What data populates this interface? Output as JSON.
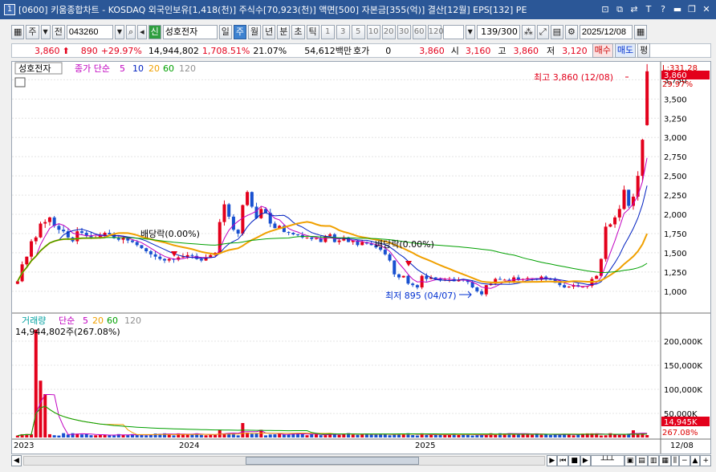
{
  "window": {
    "number": "1",
    "title": "[0600] 키움종합차트 - KOSDAQ 외국인보유[1,418(천)] 주식수[70,923(천)] 액면[500] 자본금[355(억)] 결산[12월] EPS[132] PE"
  },
  "toolbar": {
    "main_btn": "주",
    "jeon_btn": "전",
    "code_value": "043260",
    "sin_label": "신",
    "stock_name": "성호전자",
    "periods": [
      "일",
      "주",
      "월",
      "년"
    ],
    "selected_period": "주",
    "intervals": [
      "분",
      "초",
      "틱"
    ],
    "numbers": [
      "1",
      "3",
      "5",
      "10",
      "20",
      "30",
      "60",
      "120"
    ],
    "count_value": "139",
    "count_total": "/300",
    "date_value": "2025/12/08"
  },
  "quote": {
    "price": "3,860",
    "change": "890",
    "change_pct": "+29.97%",
    "volume": "14,944,802",
    "volume_pct": "1,708.51%",
    "turnover_pct": "21.07%",
    "trade_value": "54,612백만",
    "hoga_label": "호가",
    "hoga_value": "0",
    "price2": "3,860",
    "open_label": "시",
    "open": "3,160",
    "high_label": "고",
    "high": "3,860",
    "low_label": "저",
    "low": "3,120",
    "buy_btn": "매수",
    "sell_btn": "매도",
    "eval_btn": "평"
  },
  "price_panel": {
    "name_tag": "성호전자",
    "ma_label": "종가 단순",
    "ma_periods": [
      "5",
      "10",
      "20",
      "60",
      "120"
    ],
    "ma_colors": [
      "#c000c0",
      "#0020c0",
      "#f0a000",
      "#00a000",
      "#909090"
    ],
    "right_top_label": "L:331.28",
    "current_price_tag": "3,860",
    "current_pct_tag": "29.97%",
    "annotations": {
      "high_label": "최고 3,860 (12/08)",
      "low_label": "최저 895 (04/07)",
      "dividend_1": "배당락(0.00%)",
      "dividend_2": "배당락(0.00%)"
    }
  },
  "volume_panel": {
    "label": "거래량",
    "ma_label": "단순",
    "ma_periods": [
      "5",
      "20",
      "60",
      "120"
    ],
    "ma_colors": [
      "#c000c0",
      "#f0a000",
      "#00a000",
      "#909090"
    ],
    "current_value": "14,944,802주(267.08%)",
    "vol_tag": "14,945K",
    "pct_tag": "267.08%"
  },
  "x_axis": {
    "labels": [
      "2023",
      "2024",
      "2025"
    ],
    "right_label": "12/08"
  },
  "chart_data": [
    {
      "type": "candlestick",
      "title": "성호전자",
      "interval": "weekly",
      "y_ticks": [
        1000,
        1250,
        1500,
        1750,
        2000,
        2250,
        2500,
        2750,
        3000,
        3250,
        3500,
        3750
      ],
      "ylim": [
        800,
        3900
      ],
      "x_labels": [
        "2023",
        "2024",
        "2025"
      ],
      "closes": [
        1130,
        1350,
        1450,
        1650,
        1700,
        1880,
        1900,
        1960,
        1850,
        1800,
        1780,
        1700,
        1650,
        1780,
        1760,
        1720,
        1700,
        1700,
        1730,
        1760,
        1740,
        1690,
        1670,
        1700,
        1660,
        1640,
        1600,
        1560,
        1520,
        1480,
        1450,
        1420,
        1400,
        1420,
        1410,
        1440,
        1450,
        1470,
        1460,
        1420,
        1400,
        1440,
        1470,
        1500,
        1900,
        2130,
        1970,
        1800,
        1750,
        2120,
        2290,
        2100,
        1950,
        2070,
        2020,
        1880,
        1820,
        1850,
        1770,
        1760,
        1740,
        1730,
        1700,
        1700,
        1680,
        1690,
        1640,
        1720,
        1740,
        1640,
        1660,
        1700,
        1640,
        1660,
        1600,
        1640,
        1620,
        1600,
        1570,
        1540,
        1480,
        1400,
        1220,
        1180,
        1200,
        1100,
        1080,
        1050,
        1200,
        1160,
        1180,
        1160,
        1140,
        1150,
        1160,
        1130,
        1150,
        1140,
        1120,
        1050,
        1000,
        960,
        1080,
        1100,
        1160,
        1150,
        1150,
        1120,
        1180,
        1150,
        1160,
        1170,
        1170,
        1150,
        1190,
        1160,
        1150,
        1110,
        1080,
        1050,
        1060,
        1080,
        1060,
        1060,
        1070,
        1160,
        1200,
        1420,
        1840,
        1870,
        1960,
        2070,
        2320,
        2110,
        2230,
        2500,
        2970,
        3860
      ],
      "ma_series": [
        "5",
        "10",
        "20",
        "60",
        "120"
      ]
    },
    {
      "type": "bar",
      "title": "거래량",
      "y_ticks": [
        "50,000K",
        "100,000K",
        "150,000K",
        "200,000K"
      ],
      "ylim": [
        0,
        230000
      ],
      "spikes_k": [
        {
          "week": 4,
          "value": 224000
        },
        {
          "week": 5,
          "value": 118000
        },
        {
          "week": 6,
          "value": 90000
        },
        {
          "week": 44,
          "value": 16000
        },
        {
          "week": 49,
          "value": 30000
        },
        {
          "week": 50,
          "value": 10000
        },
        {
          "week": 53,
          "value": 16000
        },
        {
          "week": 134,
          "value": 14945
        }
      ]
    }
  ]
}
